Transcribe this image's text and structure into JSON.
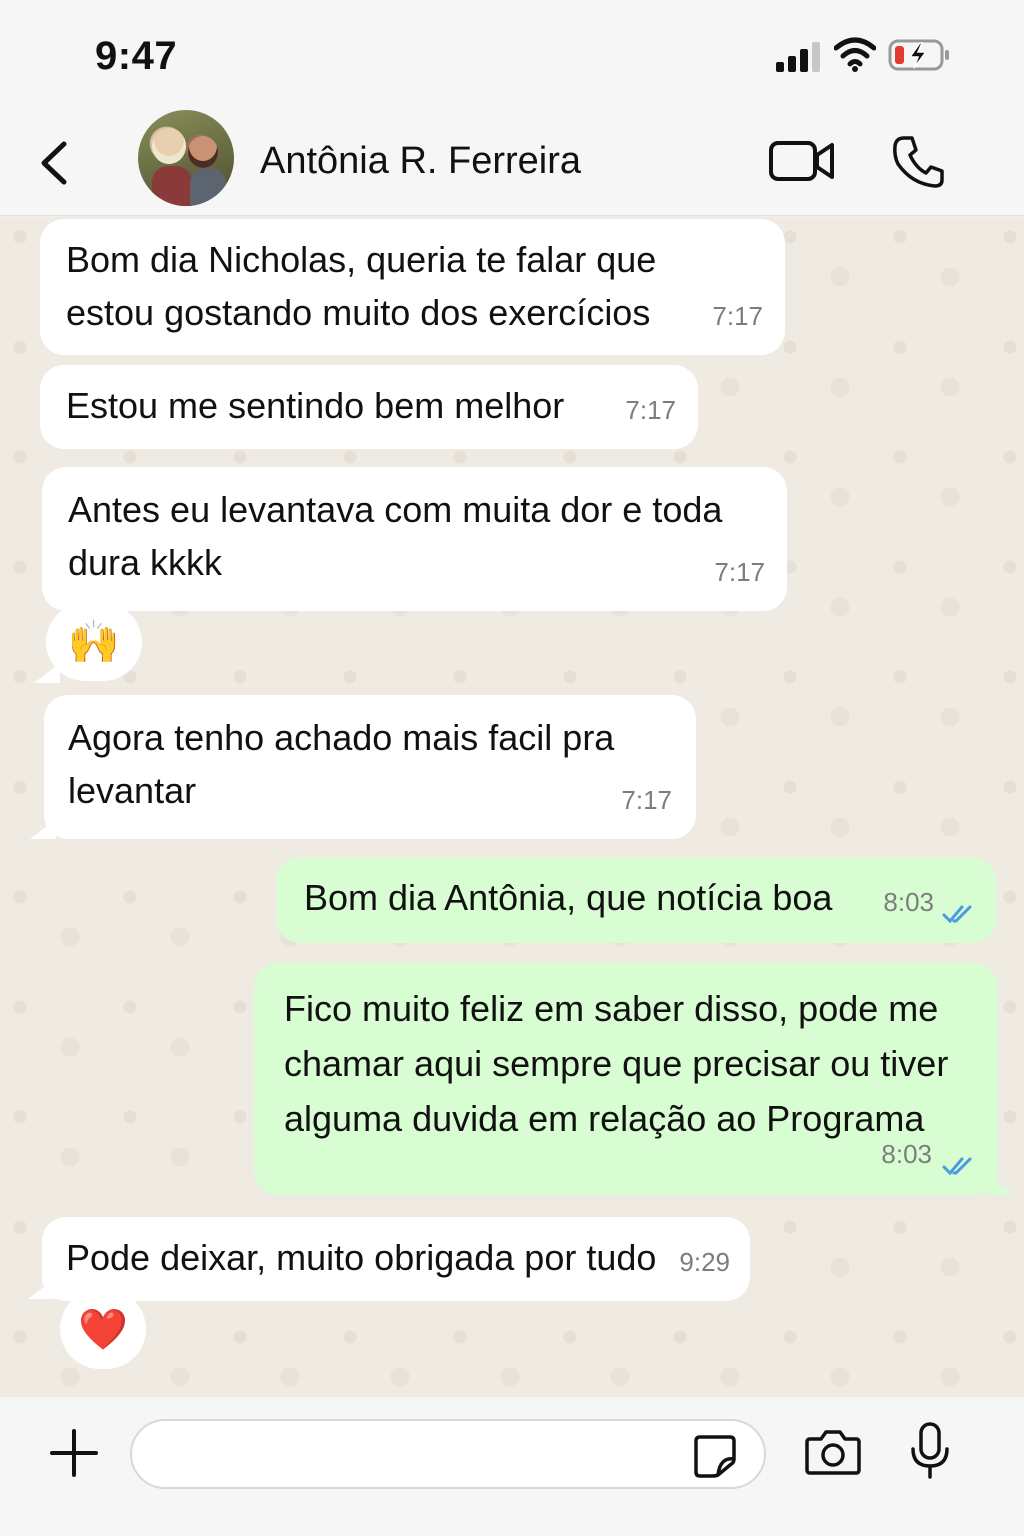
{
  "status_bar": {
    "time": "9:47",
    "icons": [
      "signal-icon",
      "wifi-icon",
      "battery-charging-icon"
    ]
  },
  "header": {
    "back_icon": "chevron-left-icon",
    "contact_name": "Antônia R. Ferreira",
    "actions": [
      "video-call-icon",
      "phone-icon"
    ]
  },
  "messages": [
    {
      "direction": "in",
      "lines": [
        "Bom dia Nicholas, queria te falar que",
        "estou gostando muito dos exercícios"
      ],
      "time": "7:17"
    },
    {
      "direction": "in",
      "lines": [
        "Estou me sentindo bem melhor"
      ],
      "time": "7:17"
    },
    {
      "direction": "in",
      "lines": [
        "Antes eu levantava com muita dor e toda",
        "dura kkkk"
      ],
      "time": "7:17",
      "reaction": "🙌"
    },
    {
      "direction": "in",
      "lines": [
        "Agora tenho achado mais facil pra",
        "levantar"
      ],
      "time": "7:17"
    },
    {
      "direction": "out",
      "lines": [
        "Bom dia Antônia, que notícia boa"
      ],
      "time": "8:03",
      "status": "read"
    },
    {
      "direction": "out",
      "lines": [
        "Fico muito feliz em saber disso, pode me",
        "chamar aqui sempre que precisar ou tiver",
        "alguma duvida em relação ao Programa"
      ],
      "time": "8:03",
      "status": "read"
    },
    {
      "direction": "in",
      "lines": [
        "Pode deixar, muito obrigada por tudo"
      ],
      "time": "9:29",
      "reaction": "❤️"
    }
  ],
  "input_bar": {
    "placeholder": "",
    "icons": [
      "plus-icon",
      "sticker-icon",
      "camera-icon",
      "microphone-icon"
    ]
  },
  "colors": {
    "incoming_bubble": "#ffffff",
    "outgoing_bubble": "#d9fdd3",
    "read_ticks": "#4a9be0",
    "chat_background": "#efeae2"
  }
}
